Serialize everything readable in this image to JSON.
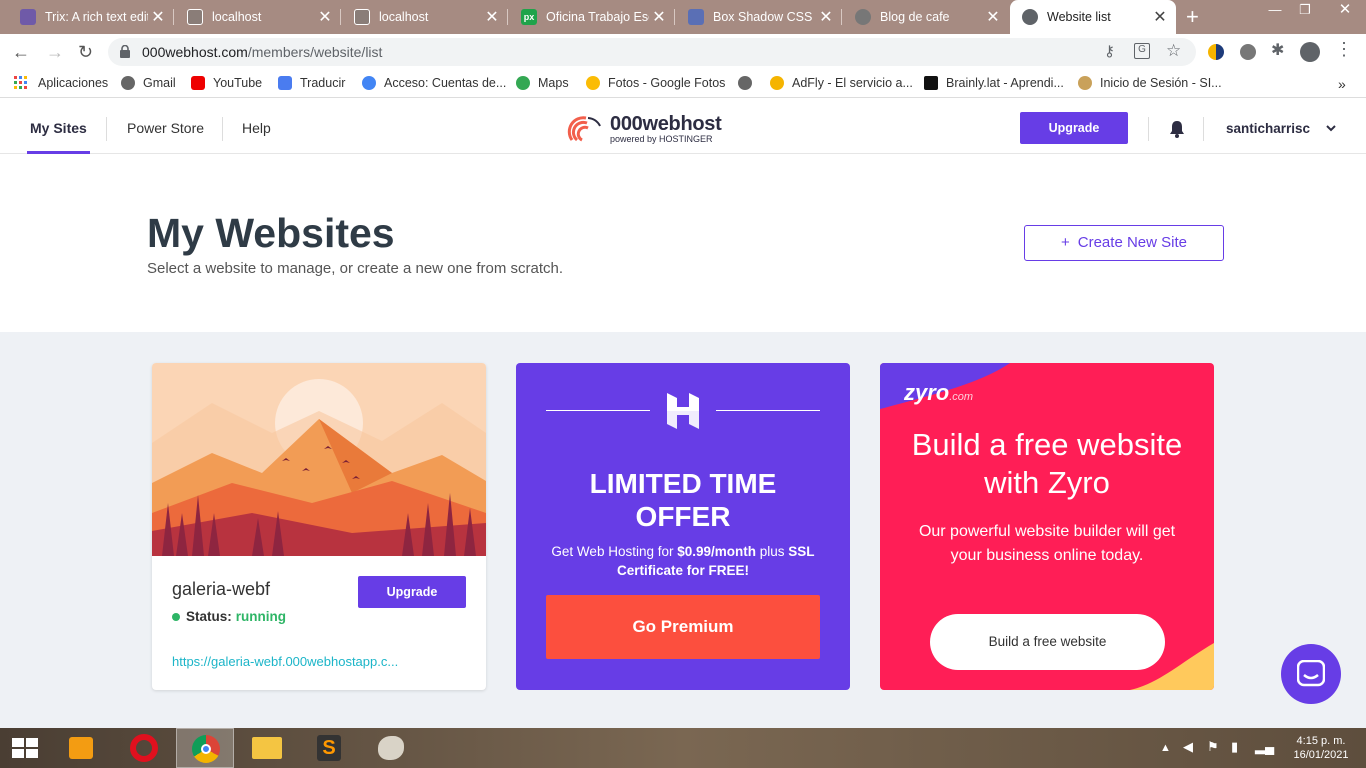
{
  "browser": {
    "tabs": [
      {
        "title": "Trix: A rich text edit",
        "fav_color": "#6f5aa8"
      },
      {
        "title": "localhost",
        "fav_color": "#888"
      },
      {
        "title": "localhost",
        "fav_color": "#888"
      },
      {
        "title": "Oficina Trabajo Esc",
        "fav_color": "#1fa34a"
      },
      {
        "title": "Box Shadow CSS Ge",
        "fav_color": "#5a6fb5"
      },
      {
        "title": "Blog de cafe",
        "fav_color": "#777"
      },
      {
        "title": "Website list",
        "fav_color": "#5f6368"
      }
    ],
    "url_host": "000webhost.com",
    "url_path": "/members/website/list",
    "bookmarks": [
      {
        "label": "Aplicaciones",
        "color": "#e44"
      },
      {
        "label": "Gmail",
        "color": "#666"
      },
      {
        "label": "YouTube",
        "color": "#e00"
      },
      {
        "label": "Traducir",
        "color": "#4a7cf0"
      },
      {
        "label": "Acceso: Cuentas de...",
        "color": "#4285f4"
      },
      {
        "label": "Maps",
        "color": "#34a853"
      },
      {
        "label": "Fotos - Google Fotos",
        "color": "#fbbc05"
      },
      {
        "label": "",
        "color": "#666"
      },
      {
        "label": "AdFly - El servicio a...",
        "color": "#f5b400"
      },
      {
        "label": "Brainly.lat - Aprendi...",
        "color": "#111"
      },
      {
        "label": "Inicio de Sesión - SI...",
        "color": "#c9a15a"
      }
    ],
    "more_bookmarks": "»"
  },
  "nav": {
    "my_sites": "My Sites",
    "power_store": "Power Store",
    "help": "Help",
    "logo_name": "000webhost",
    "logo_sub": "powered by HOSTINGER",
    "upgrade": "Upgrade",
    "username": "santicharrisc"
  },
  "hero": {
    "title": "My Websites",
    "subtitle": "Select a website to manage, or create a new one from scratch.",
    "create_button": "Create New Site"
  },
  "site_card": {
    "name": "galeria-webf",
    "status_label": "Status:",
    "status_value": "running",
    "upgrade": "Upgrade",
    "link": "https://galeria-webf.000webhostapp.c..."
  },
  "offer_card": {
    "headline_line1": "LIMITED TIME",
    "headline_line2": "OFFER",
    "text_prefix": "Get Web Hosting for ",
    "price": "$0.99/month",
    "text_mid": " plus ",
    "ssl": "SSL Certificate for FREE!",
    "cta": "Go Premium"
  },
  "zyro_card": {
    "logo": "zyro",
    "logo_suffix": ".com",
    "title_line1": "Build a free website",
    "title_line2": "with Zyro",
    "subtitle": "Our powerful website builder will get your business online today.",
    "cta": "Build a free website"
  },
  "taskbar": {
    "time": "4:15 p. m.",
    "date": "16/01/2021"
  }
}
